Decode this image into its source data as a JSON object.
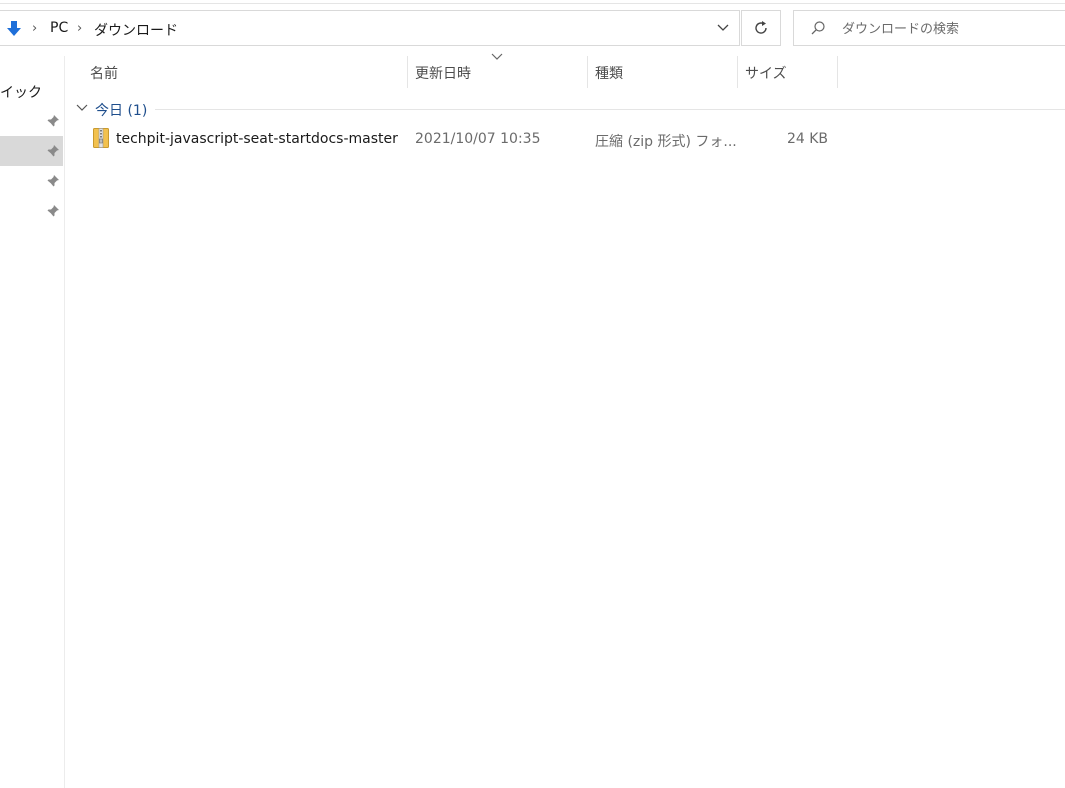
{
  "address_bar": {
    "location_icon": "download-arrow-icon",
    "breadcrumbs": [
      "PC",
      "ダウンロード"
    ],
    "dropdown_icon": "chevron-down-icon"
  },
  "refresh_icon": "refresh-icon",
  "search": {
    "placeholder": "ダウンロードの検索",
    "value": "",
    "icon": "search-icon"
  },
  "nav_pane": {
    "quick_access_label": "クイック アクセス",
    "pinned_icon": "pin-icon"
  },
  "columns": {
    "name": "名前",
    "date_modified": "更新日時",
    "type": "種類",
    "size": "サイズ"
  },
  "group": {
    "label": "今日 (1)"
  },
  "files": [
    {
      "name": "techpit-javascript-seat-startdocs-master",
      "date_modified": "2021/10/07 10:35",
      "type": "圧縮 (zip 形式) フォ...",
      "size": "24 KB",
      "icon": "zip-folder-icon"
    }
  ],
  "colors": {
    "accent_blue": "#1e6fd9",
    "group_text": "#1e4e8c",
    "selected_nav_bg": "#d9d9d9"
  }
}
